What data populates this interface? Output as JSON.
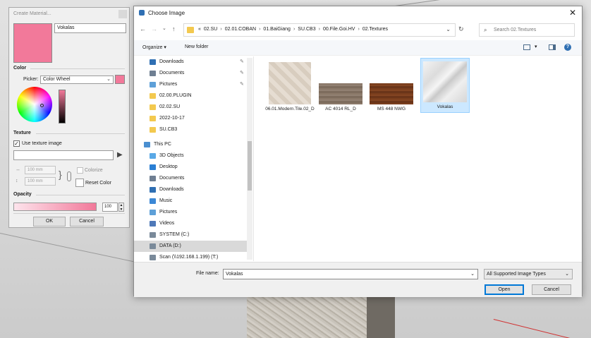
{
  "create_material": {
    "title": "Create Material...",
    "name_value": "Vokalas",
    "color_section": "Color",
    "picker_label": "Picker:",
    "picker_value": "Color Wheel",
    "color_hex": "#f2799a",
    "texture_section": "Texture",
    "use_texture_label": "Use texture image",
    "use_texture_checked": "✓",
    "width_value": "100 mm",
    "height_value": "100 mm",
    "colorize_label": "Colorize",
    "reset_color_label": "Reset Color",
    "opacity_section": "Opacity",
    "opacity_value": "100",
    "ok_label": "OK",
    "cancel_label": "Cancel"
  },
  "dialog": {
    "title": "Choose Image",
    "breadcrumbs": [
      "«",
      "02.SU",
      "›",
      "02.01.COBAN",
      "›",
      "01.BaiGiang",
      "›",
      "SU.CB3",
      "›",
      "00.File.Goi.HV",
      "›",
      "02.Textures"
    ],
    "search_placeholder": "Search 02.Textures",
    "organize_label": "Organize ▾",
    "new_folder_label": "New folder",
    "nav_items": [
      {
        "label": "Downloads",
        "icon": "download-icon",
        "pinned": true
      },
      {
        "label": "Documents",
        "icon": "documents-icon",
        "pinned": true
      },
      {
        "label": "Pictures",
        "icon": "pictures-icon",
        "pinned": true
      },
      {
        "label": "02.00.PLUGIN",
        "icon": "folder-icon",
        "pinned": false
      },
      {
        "label": "02.02.SU",
        "icon": "folder-icon",
        "pinned": false
      },
      {
        "label": "2022-10-17",
        "icon": "folder-icon",
        "pinned": false
      },
      {
        "label": "SU.CB3",
        "icon": "folder-icon",
        "pinned": false
      },
      {
        "label": "This PC",
        "icon": "pc-icon",
        "pinned": false
      },
      {
        "label": "3D Objects",
        "icon": "cube-icon",
        "pinned": false
      },
      {
        "label": "Desktop",
        "icon": "desktop-icon",
        "pinned": false
      },
      {
        "label": "Documents",
        "icon": "documents-icon",
        "pinned": false
      },
      {
        "label": "Downloads",
        "icon": "download-icon",
        "pinned": false
      },
      {
        "label": "Music",
        "icon": "music-icon",
        "pinned": false
      },
      {
        "label": "Pictures",
        "icon": "pictures-icon",
        "pinned": false
      },
      {
        "label": "Videos",
        "icon": "videos-icon",
        "pinned": false
      },
      {
        "label": "SYSTEM (C:)",
        "icon": "drive-icon",
        "pinned": false
      },
      {
        "label": "DATA (D:)",
        "icon": "drive-icon",
        "pinned": false
      },
      {
        "label": "Scan (\\\\192.168.1.199) (T:)",
        "icon": "network-drive-icon",
        "pinned": false
      }
    ],
    "files": [
      {
        "name": "06.01.Modern.Tile.02_D",
        "kind": "tile-texture"
      },
      {
        "name": "AC 4014 RL_D",
        "kind": "light-wood-texture"
      },
      {
        "name": "MS 448 NWG",
        "kind": "dark-wood-texture"
      },
      {
        "name": "Vokalas",
        "kind": "marble-texture",
        "selected": true
      }
    ],
    "file_name_label": "File name:",
    "file_name_value": "Vokalas",
    "file_type_value": "All Supported Image Types",
    "open_label": "Open",
    "cancel_label": "Cancel"
  },
  "colors": {
    "accent_pink": "#f2799a",
    "selection_blue": "#cce8ff",
    "primary_button_border": "#0078d7"
  }
}
